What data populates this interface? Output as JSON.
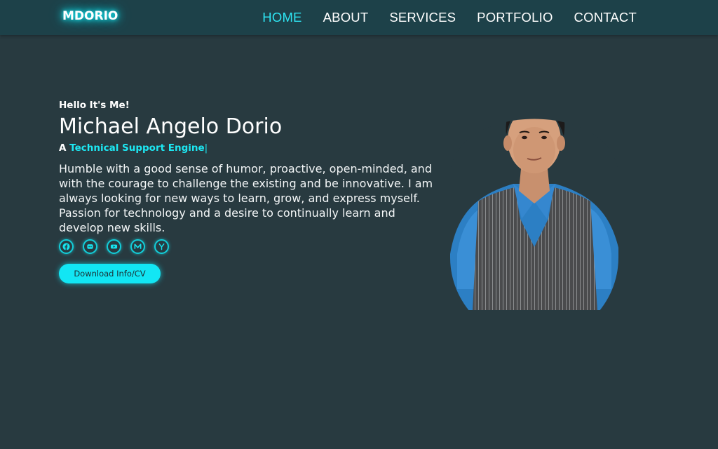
{
  "nav": {
    "logo": "MDORIO",
    "links": [
      "HOME",
      "ABOUT",
      "SERVICES",
      "PORTFOLIO",
      "CONTACT"
    ],
    "active": "HOME"
  },
  "hero": {
    "greeting": "Hello It's Me!",
    "name": "Michael Angelo Dorio",
    "role_prefix": "A",
    "role": "Technical Support Engine",
    "cursor": "|",
    "bio": "Humble with a good sense of humor, proactive, open-minded, and with the courage to challenge the existing and be innovative. I am always looking for new ways to learn, grow, and express myself. Passion for technology and a desire to continually learn and develop new skills.",
    "socials": [
      "facebook-icon",
      "discord-icon",
      "youtube-icon",
      "medium-icon",
      "ycombinator-icon"
    ],
    "cta_label": "Download Info/CV"
  },
  "colors": {
    "background": "#283a40",
    "navbar": "#1d4149",
    "accent": "#12e6f4"
  }
}
